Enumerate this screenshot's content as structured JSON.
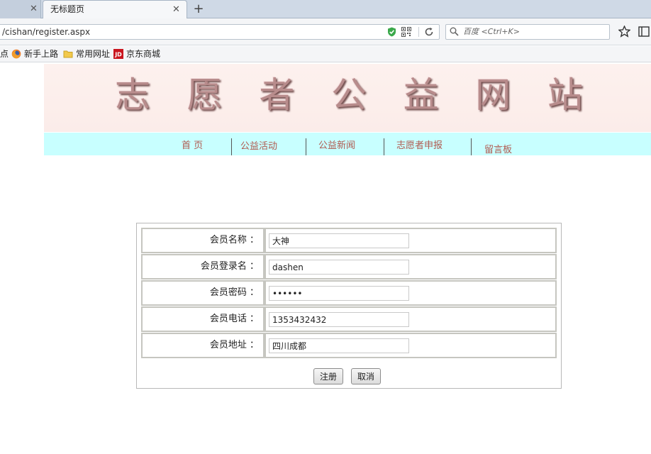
{
  "browser": {
    "tabs": [
      {
        "title": "",
        "active": false
      },
      {
        "title": "无标题页",
        "active": true
      }
    ],
    "new_tab": "+",
    "url": "/cishan/register.aspx",
    "search_placeholder": "百度 <Ctrl+K>",
    "bookmarks": [
      "点",
      "新手上路",
      "常用网址",
      "京东商城"
    ],
    "bookmark_icons": [
      "",
      "firefox-icon",
      "folder-icon",
      "jd-icon"
    ]
  },
  "site": {
    "title_chars": [
      "志",
      "愿",
      "者",
      "公",
      "益",
      "网",
      "站"
    ],
    "nav": [
      "首 页",
      "公益活动",
      "公益新闻",
      "志愿者申报",
      "留言板"
    ]
  },
  "form": {
    "rows": [
      {
        "label": "会员名称 ：",
        "value": "大神",
        "type": "text"
      },
      {
        "label": "会员登录名 ：",
        "value": "dashen",
        "type": "text"
      },
      {
        "label": "会员密码 ：",
        "value": "xxxxxx",
        "type": "password"
      },
      {
        "label": "会员电话 ：",
        "value": "1353432432",
        "type": "text"
      },
      {
        "label": "会员地址 ：",
        "value": "四川成都",
        "type": "text"
      }
    ],
    "submit_label": "注册",
    "cancel_label": "取消"
  },
  "colors": {
    "banner_bg": "#fdf1ee",
    "nav_bg": "#c8ffff",
    "nav_text": "#b05a50",
    "title_color": "#b88c8c"
  }
}
